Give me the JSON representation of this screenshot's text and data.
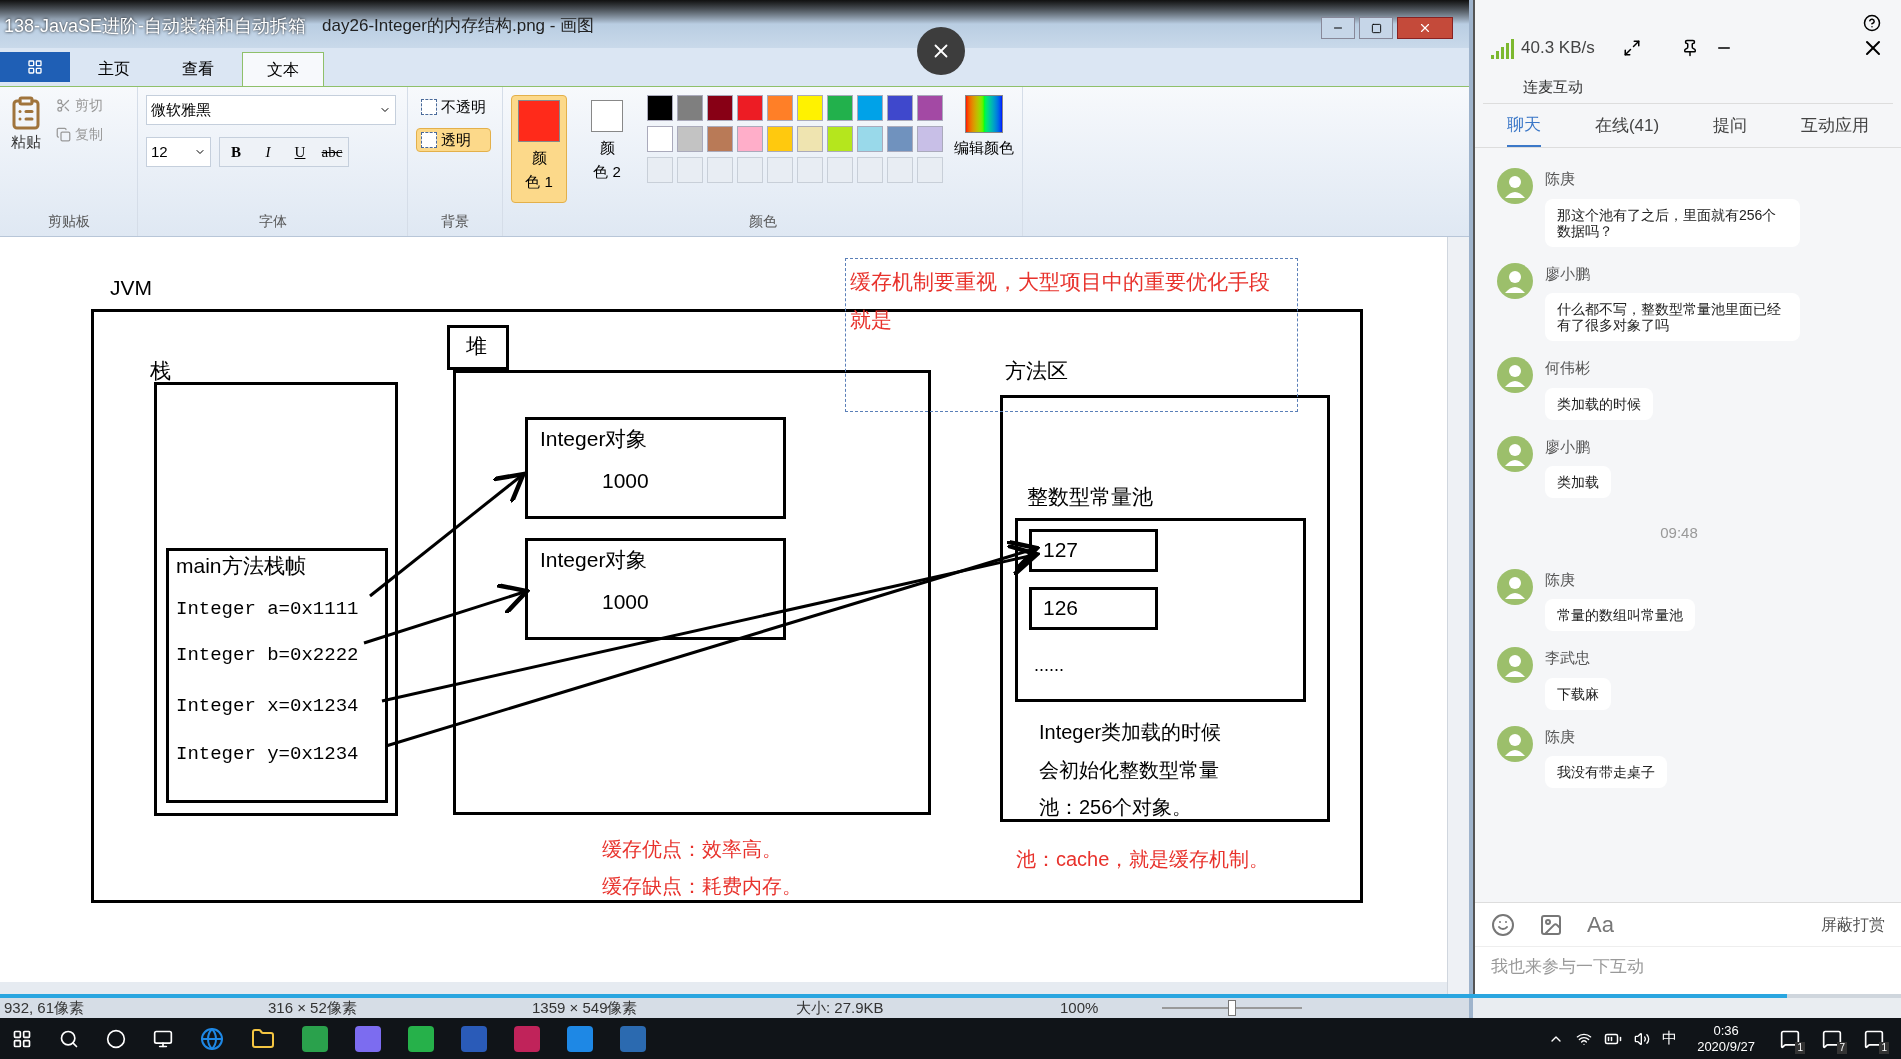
{
  "video_title": "138-JavaSE进阶-自动装箱和自动拆箱",
  "window": {
    "title": "day26-Integer的内存结构.png - 画图"
  },
  "ribbon_tabs": [
    {
      "label": "主页",
      "selected": false
    },
    {
      "label": "查看",
      "selected": false
    },
    {
      "label": "文本",
      "selected": true
    }
  ],
  "clipboard": {
    "paste": "粘贴",
    "cut": "剪切",
    "copy": "复制",
    "group": "剪贴板"
  },
  "font": {
    "family": "微软雅黑",
    "size": "12",
    "styles": [
      "B",
      "I",
      "U",
      "abc"
    ],
    "group": "字体"
  },
  "background": {
    "options": [
      {
        "label": "不透明",
        "selected": false
      },
      {
        "label": "透明",
        "selected": true
      }
    ],
    "group": "背景"
  },
  "colors": {
    "slots": [
      {
        "label": "颜色 1",
        "color": "#ff2a1a",
        "selected": true
      },
      {
        "label": "颜色 2",
        "color": "#ffffff",
        "selected": false
      }
    ],
    "palette": [
      {
        "color": "#000000"
      },
      {
        "color": "#7f7f7f"
      },
      {
        "color": "#880015"
      },
      {
        "color": "#ed1c24"
      },
      {
        "color": "#ff7f27"
      },
      {
        "color": "#fff200"
      },
      {
        "color": "#22b14c"
      },
      {
        "color": "#00a2e8"
      },
      {
        "color": "#3f48cc"
      },
      {
        "color": "#a349a4"
      },
      {
        "color": "#ffffff"
      },
      {
        "color": "#c3c3c3"
      },
      {
        "color": "#b97a57"
      },
      {
        "color": "#ffaec9"
      },
      {
        "color": "#ffc90e"
      },
      {
        "color": "#efe4b0"
      },
      {
        "color": "#b5e61d"
      },
      {
        "color": "#99d9ea"
      },
      {
        "color": "#7092be"
      },
      {
        "color": "#c8bfe7"
      }
    ],
    "edit": "编辑颜色",
    "group": "颜色"
  },
  "canvas": {
    "labels": {
      "jvm": "JVM",
      "stack": "栈",
      "heap": "堆",
      "method_area": "方法区",
      "pool": "整数型常量池"
    },
    "stack_frame": {
      "title": "main方法栈帧",
      "lines": [
        "Integer a=0x1111",
        "Integer b=0x2222",
        "Integer x=0x1234",
        "Integer y=0x1234"
      ]
    },
    "heap_objects": [
      {
        "title": "Integer对象",
        "value": "1000"
      },
      {
        "title": "Integer对象",
        "value": "1000"
      }
    ],
    "pool_values": [
      "127",
      "126"
    ],
    "pool_more": "......",
    "pool_note": [
      "Integer类加载的时候",
      "会初始化整数型常量",
      "池：256个对象。"
    ],
    "heap_notes": [
      "缓存优点：效率高。",
      "缓存缺点：耗费内存。"
    ],
    "method_note": "池：cache，就是缓存机制。",
    "text_box": {
      "text": "缓存机制要重视，大型项目中的重要优化手段就是"
    }
  },
  "status_bar": {
    "cursor": "932, 61像素",
    "selection": "316 × 52像素",
    "image_size": "1359 × 549像素",
    "file_size": "大小: 27.9KB",
    "zoom": "100%",
    "zoom_slider": {
      "level": 0.5
    }
  },
  "video_progress": {
    "level": 0.94
  },
  "chat": {
    "speed": "40.3 KB/s",
    "section": "连麦互动",
    "tabs": [
      {
        "label": "聊天",
        "selected": true
      },
      {
        "label": "在线(41)",
        "selected": false
      },
      {
        "label": "提问",
        "selected": false
      },
      {
        "label": "互动应用",
        "selected": false
      }
    ],
    "feed": [
      {
        "kind": "message",
        "name": "陈庚",
        "text": "那这个池有了之后，里面就有256个数据吗？"
      },
      {
        "kind": "message",
        "name": "廖小鹏",
        "text": "什么都不写，整数型常量池里面已经有了很多对象了吗"
      },
      {
        "kind": "message",
        "name": "何伟彬",
        "text": "类加载的时候"
      },
      {
        "kind": "message",
        "name": "廖小鹏",
        "text": "类加载"
      },
      {
        "kind": "time",
        "text": "09:48"
      },
      {
        "kind": "message",
        "name": "陈庚",
        "text": "常量的数组叫常量池"
      },
      {
        "kind": "message",
        "name": "李武忠",
        "text": "下载麻"
      },
      {
        "kind": "message",
        "name": "陈庚",
        "text": "我没有带走桌子"
      }
    ],
    "format_button": "Aa",
    "reward_toggle": "屏蔽打赏",
    "input_placeholder": "我也来参与一下互动"
  },
  "taskbar": {
    "ime": "中",
    "time": "0:36",
    "date": "2020/9/27",
    "badges": [
      "1",
      "7",
      "1"
    ]
  }
}
